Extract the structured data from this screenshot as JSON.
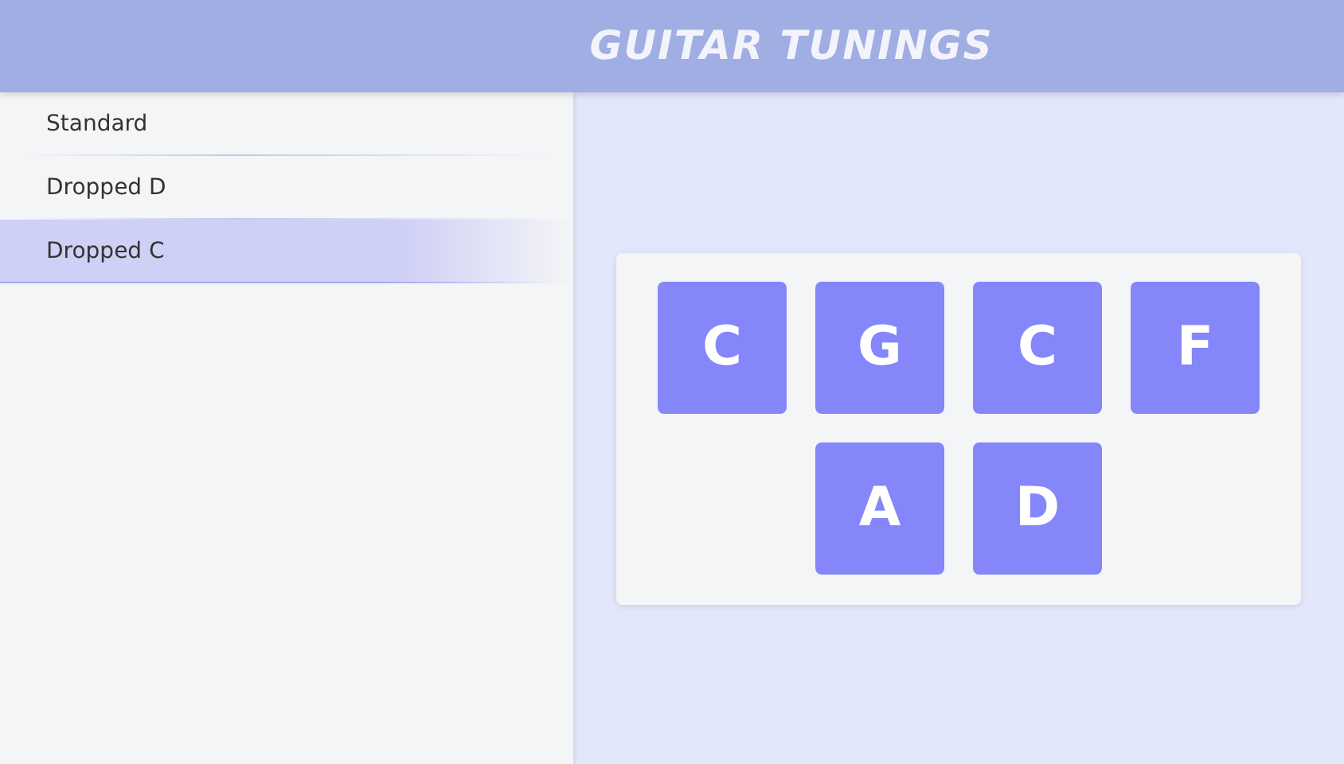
{
  "header": {
    "title": "GUITAR TUNINGS"
  },
  "tunings": [
    {
      "label": "Standard",
      "selected": false
    },
    {
      "label": "Dropped D",
      "selected": false
    },
    {
      "label": "Dropped C",
      "selected": true
    }
  ],
  "strings": [
    {
      "note": "C"
    },
    {
      "note": "G"
    },
    {
      "note": "C"
    },
    {
      "note": "F"
    },
    {
      "note": "A"
    },
    {
      "note": "D"
    }
  ]
}
